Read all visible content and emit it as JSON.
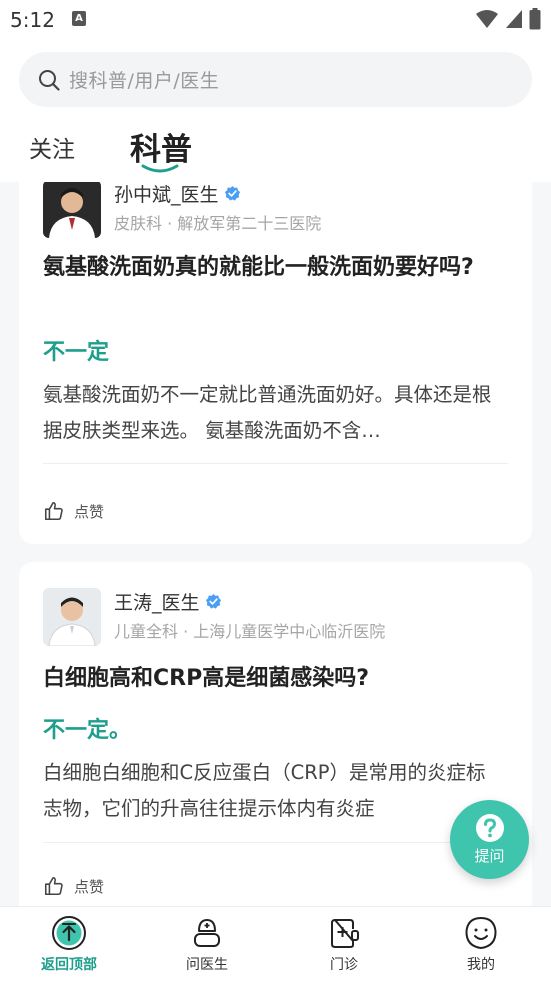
{
  "status_bar": {
    "time": "5:12",
    "notif_glyph": "A"
  },
  "search": {
    "placeholder": "搜科普/用户/医生"
  },
  "tabs": [
    {
      "label": "关注"
    },
    {
      "label": "科普"
    }
  ],
  "cards": [
    {
      "doctor_name": "孙中斌_医生",
      "department": "皮肤科 · 解放军第二十三医院",
      "question": "氨基酸洗面奶真的就能比一般洗面奶要好吗?",
      "answer_short": "不一定",
      "answer_body": "氨基酸洗面奶不一定就比普通洗面奶好。具体还是根据皮肤类型来选。 氨基酸洗面奶不含…",
      "like_label": "点赞"
    },
    {
      "doctor_name": "王涛_医生",
      "department": "儿童全科 · 上海儿童医学中心临沂医院",
      "question": "白细胞高和CRP高是细菌感染吗?",
      "answer_short": "不一定。",
      "answer_body": "白细胞白细胞和C反应蛋白（CRP）是常用的炎症标志物，它们的升高往往提示体内有炎症",
      "like_label": "点赞"
    }
  ],
  "ask_button": {
    "label": "提问"
  },
  "bottom_nav": [
    {
      "label": "返回顶部",
      "icon": "back-to-top-icon",
      "active": true
    },
    {
      "label": "问医生",
      "icon": "doctor-icon",
      "active": false
    },
    {
      "label": "门诊",
      "icon": "clinic-icon",
      "active": false
    },
    {
      "label": "我的",
      "icon": "profile-icon",
      "active": false
    }
  ],
  "colors": {
    "accent": "#1e9e8c",
    "fab": "#3fc4ad",
    "verified": "#4a9ff5"
  }
}
